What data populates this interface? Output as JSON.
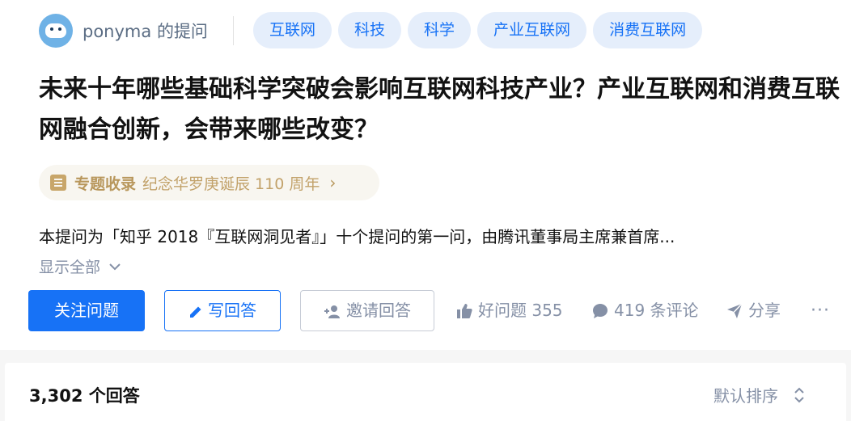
{
  "author": {
    "name": "ponyma",
    "suffix": "的提问"
  },
  "topics": [
    "互联网",
    "科技",
    "科学",
    "产业互联网",
    "消费互联网"
  ],
  "question": {
    "title": "未来十年哪些基础科学突破会影响互联网科技产业？产业互联网和消费互联网融合创新，会带来哪些改变？",
    "excerpt": "本提问为「知乎 2018『互联网洞见者』」十个提问的第一问，由腾讯董事局主席兼首席...",
    "show_all": "显示全部"
  },
  "collection": {
    "label": "专题收录",
    "name": "纪念华罗庚诞辰 110 周年"
  },
  "actions": {
    "follow": "关注问题",
    "write": "写回答",
    "invite": "邀请回答",
    "like": "好问题 355",
    "comments": "419 条评论",
    "share": "分享",
    "more": "···"
  },
  "answers": {
    "count": "3,302 个回答",
    "sort": "默认排序"
  },
  "colors": {
    "accent": "#1772f6",
    "topic_bg": "#e5eefb",
    "muted": "#8590a6",
    "collection": "#b8975c"
  }
}
